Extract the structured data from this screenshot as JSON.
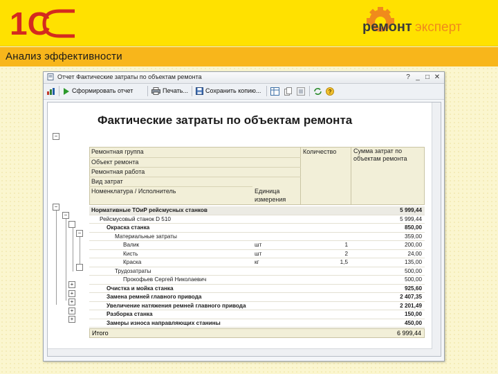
{
  "slide": {
    "section_title": "Анализ эффективности",
    "brand_left": "1С",
    "brand_word1": "ремонт",
    "brand_word2": "эксперт",
    "colors": {
      "header_yellow": "#ffe100",
      "band_orange": "#f8b61b",
      "brand_red": "#d42a1f",
      "brand_dark": "#3a3a3a",
      "brand_orange": "#f08a1c"
    }
  },
  "window": {
    "title": "Отчет  Фактические затраты по объектам ремонта",
    "toolbar": {
      "generate_label": "Сформировать отчет",
      "print_label": "Печать...",
      "save_copy_label": "Сохранить копию..."
    }
  },
  "report": {
    "title": "Фактические затраты по объектам ремонта",
    "header_groups": [
      "Ремонтная группа",
      "Объект ремонта",
      "Ремонтная работа",
      "Вид затрат"
    ],
    "header_nomenclature": "Номенклатура / Исполнитель",
    "header_unit": "Единица измерения",
    "header_qty": "Количество",
    "header_sum": "Сумма затрат по объектам ремонта",
    "rows": [
      {
        "label": "Нормативные ТОиР рейсмусных станков",
        "unit": "",
        "qty": "",
        "sum": "5 999,44",
        "level": 0
      },
      {
        "label": "Рейсмусовый станок D 510",
        "unit": "",
        "qty": "",
        "sum": "5 999,44",
        "level": 1
      },
      {
        "label": "Окраска станка",
        "unit": "",
        "qty": "",
        "sum": "850,00",
        "level": 2
      },
      {
        "label": "Материальные затраты",
        "unit": "",
        "qty": "",
        "sum": "359,00",
        "level": 3
      },
      {
        "label": "Валик",
        "unit": "шт",
        "qty": "1",
        "sum": "200,00",
        "level": 4
      },
      {
        "label": "Кисть",
        "unit": "шт",
        "qty": "2",
        "sum": "24,00",
        "level": 4
      },
      {
        "label": "Краска",
        "unit": "кг",
        "qty": "1,5",
        "sum": "135,00",
        "level": 4
      },
      {
        "label": "Трудозатраты",
        "unit": "",
        "qty": "",
        "sum": "500,00",
        "level": 3
      },
      {
        "label": "Прокофьев Сергей Николаевич",
        "unit": "",
        "qty": "",
        "sum": "500,00",
        "level": 4
      },
      {
        "label": "Очистка и мойка станка",
        "unit": "",
        "qty": "",
        "sum": "925,60",
        "level": 2
      },
      {
        "label": "Замена ремней главного привода",
        "unit": "",
        "qty": "",
        "sum": "2 407,35",
        "level": 2
      },
      {
        "label": "Увеличение натяжения ремней главного привода",
        "unit": "",
        "qty": "",
        "sum": "2 201,49",
        "level": 2
      },
      {
        "label": "Разборка станка",
        "unit": "",
        "qty": "",
        "sum": "150,00",
        "level": 2
      },
      {
        "label": "Замеры износа направляющих станины",
        "unit": "",
        "qty": "",
        "sum": "450,00",
        "level": 2
      }
    ],
    "total_label": "Итого",
    "total_sum": "6 999,44"
  }
}
